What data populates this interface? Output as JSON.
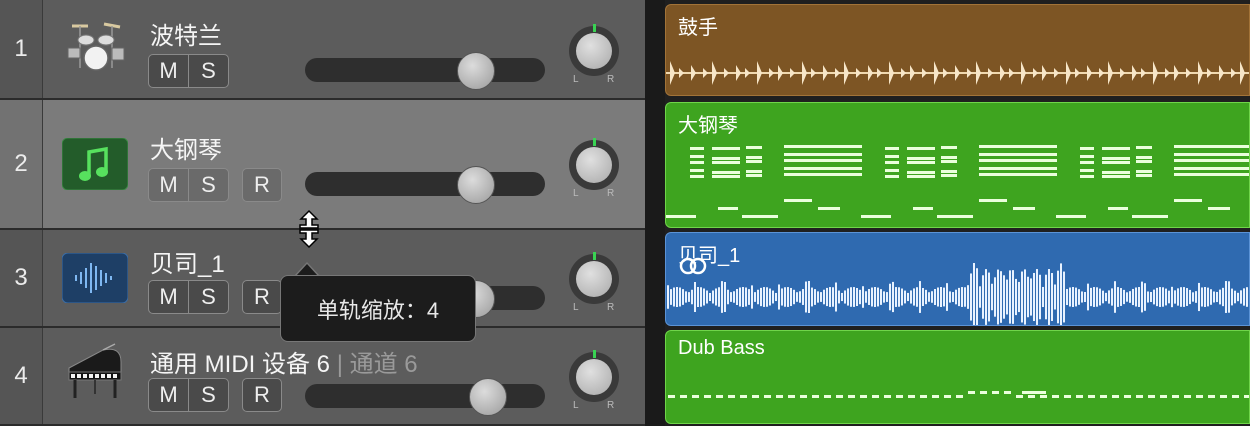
{
  "tracks": [
    {
      "number": "1",
      "name": "波特兰",
      "mute": "M",
      "solo": "S",
      "icon": "drum-kit-icon"
    },
    {
      "number": "2",
      "name": "大钢琴",
      "mute": "M",
      "solo": "S",
      "record": "R",
      "icon": "music-note-icon"
    },
    {
      "number": "3",
      "name": "贝司_1",
      "mute": "M",
      "solo": "S",
      "record": "R",
      "icon": "waveform-icon"
    },
    {
      "number": "4",
      "name": "通用 MIDI 设备 6",
      "name_sub": "通道 6",
      "mute": "M",
      "solo": "S",
      "record": "R",
      "icon": "grand-piano-icon"
    }
  ],
  "pan": {
    "left": "L",
    "right": "R"
  },
  "regions": [
    {
      "name": "鼓手",
      "color": "#7d5524"
    },
    {
      "name": "大钢琴",
      "color": "#3ea41f"
    },
    {
      "name": "贝司_1",
      "color": "#2f6ab0",
      "badge": "loop-icon"
    },
    {
      "name": "Dub Bass",
      "color": "#3ea41f"
    }
  ],
  "tooltip": {
    "text": "单轨缩放：4"
  },
  "cursor": "resize-vertical-icon"
}
